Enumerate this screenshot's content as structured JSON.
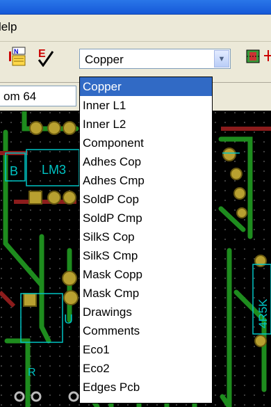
{
  "menu": {
    "help_label": "lelp"
  },
  "toolbar": {
    "layer_select": {
      "value": "Copper",
      "options": [
        "Copper",
        "Inner L1",
        "Inner L2",
        "Component",
        "Adhes Cop",
        "Adhes Cmp",
        "SoldP Cop",
        "SoldP Cmp",
        "SilkS Cop",
        "SilkS Cmp",
        "Mask Copp",
        "Mask Cmp",
        "Drawings",
        "Comments",
        "Eco1",
        "Eco2",
        "Edges Pcb"
      ],
      "selected_index": 0
    }
  },
  "zoom": {
    "label": "om 64"
  },
  "pcb": {
    "labels": [
      "LM3",
      "B",
      "U",
      "R",
      "4R5K"
    ],
    "colors": {
      "board": "#000000",
      "copper_top": "#1e8c1e",
      "copper_bottom": "#8c1c1c",
      "pad": "#b8a030",
      "silkscreen": "#00c4c4",
      "grid": "#6a6a6a"
    }
  },
  "colors": {
    "selection": "#316ac5",
    "chrome": "#ece9d8",
    "titlebar": "#1f66df"
  }
}
